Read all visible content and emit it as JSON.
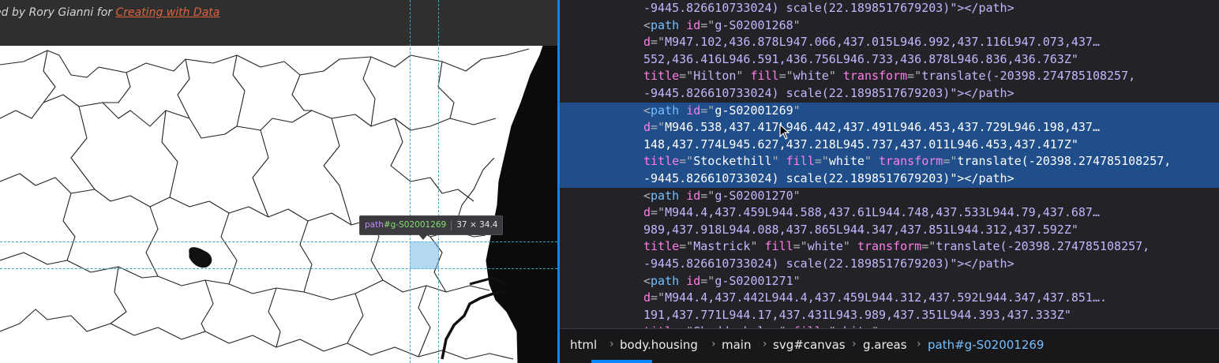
{
  "page": {
    "credit_prefix": "ed by Rory Gianni for ",
    "credit_link": "Creating with Data"
  },
  "tooltip": {
    "tag": "path",
    "id": "#g-S02001269",
    "size": "37 × 34.4"
  },
  "markup": {
    "top_fragment": "-9445.826610733024) scale(22.1898517679203)\"></path>",
    "nodes": [
      {
        "id": "g-S02001268",
        "d1": "M947.102,436.878L947.066,437.015L946.992,437.116L947.073,437…",
        "d2": "552,436.416L946.591,436.756L946.733,436.878L946.836,436.763Z\"",
        "title": "Hilton",
        "fill": "white",
        "t1": "translate(-20398.274785108257,",
        "t2": "-9445.826610733024) scale(22.1898517679203)",
        "close": "\"></path>",
        "selected": false
      },
      {
        "id": "g-S02001269",
        "d1": "M946.538,437.417L946.442,437.491L946.453,437.729L946.198,437…",
        "d2": "148,437.774L945.627,437.218L945.737,437.011L946.453,437.417Z\"",
        "title": "Stockethill",
        "fill": "white",
        "t1": "translate(-20398.274785108257,",
        "t2": "-9445.826610733024) scale(22.1898517679203)",
        "close": "\"></path>",
        "selected": true
      },
      {
        "id": "g-S02001270",
        "d1": "M944.4,437.459L944.588,437.61L944.748,437.533L944.79,437.687…",
        "d2": "989,437.918L944.088,437.865L944.347,437.851L944.312,437.592Z\"",
        "title": "Mastrick",
        "fill": "white",
        "t1": "translate(-20398.274785108257,",
        "t2": "-9445.826610733024) scale(22.1898517679203)",
        "close": "\"></path>",
        "selected": false
      },
      {
        "id": "g-S02001271",
        "d1": "M944.4,437.442L944.4,437.459L944.312,437.592L944.347,437.851….",
        "d2": "191,437.771L944.17,437.431L943.989,437.351L944.393,437.333Z\"",
        "title": "Sheddocksley",
        "fill": "white",
        "t1": "",
        "t2": "",
        "close": "",
        "selected": false
      }
    ]
  },
  "breadcrumbs": [
    "html",
    "body.housing",
    "main",
    "svg#canvas",
    "g.areas",
    "path#g-S02001269"
  ],
  "colors": {
    "accent": "#0a84ff",
    "selection": "#204e8a",
    "tag": "#75bfff",
    "attr_name": "#ff7de9",
    "attr_value": "#c4b5fd",
    "link": "#e0633e",
    "highlight": "#72bae1"
  },
  "icons": {
    "cursor": "mouse-pointer-icon",
    "separator": "chevron-right-icon"
  }
}
